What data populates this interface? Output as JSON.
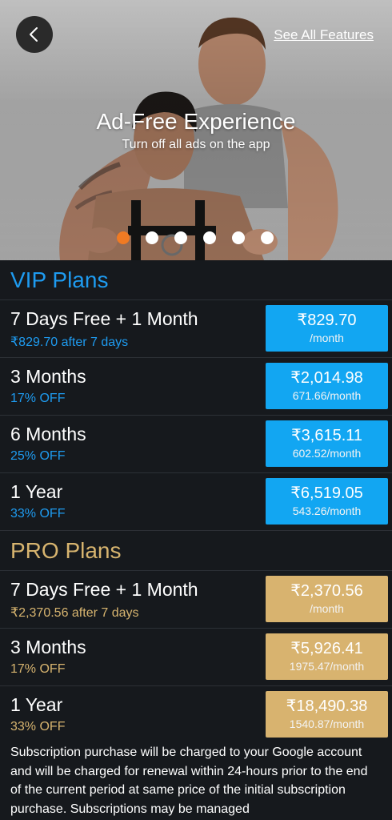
{
  "header": {
    "see_all_label": "See All Features"
  },
  "hero": {
    "title": "Ad-Free Experience",
    "subtitle": "Turn off all ads on the app",
    "carousel_active_index": 0,
    "carousel_count": 6
  },
  "vip": {
    "title": "VIP Plans",
    "plans": [
      {
        "name": "7 Days Free + 1 Month",
        "sub": "₹829.70 after 7 days",
        "price": "₹829.70",
        "per": "/month"
      },
      {
        "name": "3 Months",
        "sub": "17% OFF",
        "price": "₹2,014.98",
        "per": "671.66/month"
      },
      {
        "name": "6 Months",
        "sub": "25% OFF",
        "price": "₹3,615.11",
        "per": "602.52/month"
      },
      {
        "name": "1 Year",
        "sub": "33% OFF",
        "price": "₹6,519.05",
        "per": "543.26/month"
      }
    ]
  },
  "pro": {
    "title": "PRO Plans",
    "plans": [
      {
        "name": "7 Days Free + 1 Month",
        "sub": "₹2,370.56 after 7 days",
        "price": "₹2,370.56",
        "per": "/month"
      },
      {
        "name": "3 Months",
        "sub": "17% OFF",
        "price": "₹5,926.41",
        "per": "1975.47/month"
      },
      {
        "name": "1 Year",
        "sub": "33% OFF",
        "price": "₹18,490.38",
        "per": "1540.87/month"
      }
    ]
  },
  "disclaimer": "Subscription purchase will be charged to your Google account and will be charged for renewal within 24-hours prior to the end of the current period at same price of the initial subscription purchase. Subscriptions may be managed",
  "colors": {
    "vip_accent": "#1e9bf0",
    "vip_button": "#12a6f2",
    "pro_accent": "#d7b46f",
    "pro_button": "#d8b36f",
    "dot_active": "#f07a23",
    "background": "#16191d"
  },
  "icons": {
    "back": "chevron-left-icon"
  }
}
